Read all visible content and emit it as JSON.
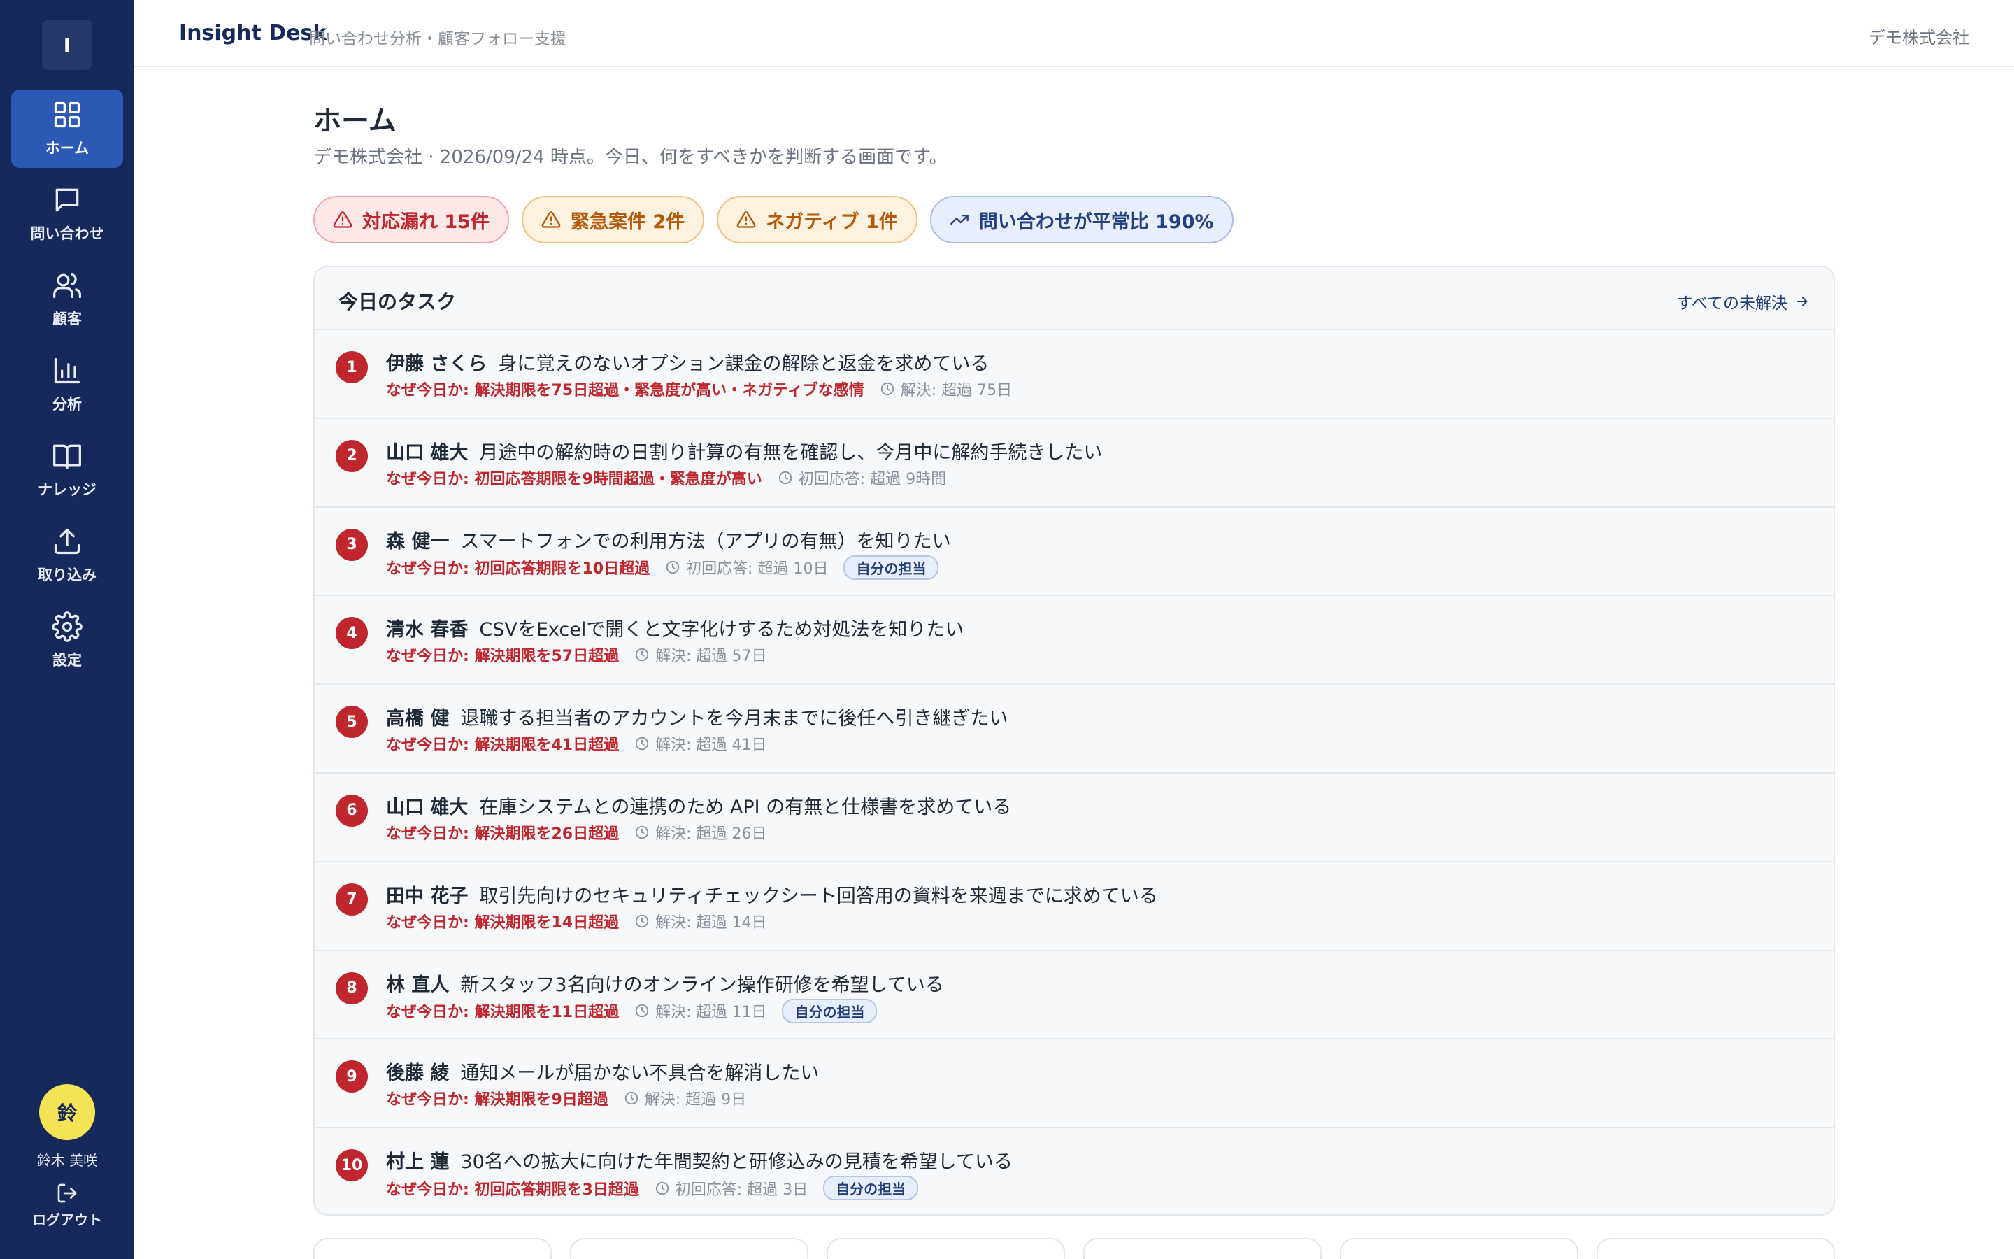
{
  "app": {
    "logo_letter": "I",
    "brand": "Insight Desk",
    "tagline": "問い合わせ分析・顧客フォロー支援",
    "company": "デモ株式会社"
  },
  "sidebar": {
    "items": [
      {
        "label": "ホーム",
        "icon": "grid-icon",
        "active": true
      },
      {
        "label": "問い合わせ",
        "icon": "chat-icon",
        "active": false
      },
      {
        "label": "顧客",
        "icon": "users-icon",
        "active": false
      },
      {
        "label": "分析",
        "icon": "bar-chart-icon",
        "active": false
      },
      {
        "label": "ナレッジ",
        "icon": "book-icon",
        "active": false
      },
      {
        "label": "取り込み",
        "icon": "upload-icon",
        "active": false
      },
      {
        "label": "設定",
        "icon": "gear-icon",
        "active": false
      }
    ],
    "user": {
      "avatar_initial": "鈴",
      "name": "鈴木 美咲"
    },
    "logout_label": "ログアウト"
  },
  "page": {
    "title": "ホーム",
    "subtitle": "デモ株式会社 · 2026/09/24 時点。今日、何をすべきかを判断する画面です。"
  },
  "alerts": [
    {
      "label": "対応漏れ 15件",
      "icon": "warning-icon",
      "tone": "red"
    },
    {
      "label": "緊急案件 2件",
      "icon": "warning-icon",
      "tone": "orange"
    },
    {
      "label": "ネガティブ 1件",
      "icon": "warning-icon",
      "tone": "orange"
    },
    {
      "label": "問い合わせが平常比 190%",
      "icon": "trending-up-icon",
      "tone": "blue"
    }
  ],
  "tasks": {
    "title": "今日のタスク",
    "view_all_label": "すべての未解決",
    "rows": [
      {
        "num": "1",
        "name": "伊藤 さくら",
        "summary": "身に覚えのないオプション課金の解除と返金を求めている",
        "reason": "なぜ今日か: 解決期限を75日超過・緊急度が高い・ネガティブな感情",
        "meta": "解決: 超過 75日",
        "badge": ""
      },
      {
        "num": "2",
        "name": "山口 雄大",
        "summary": "月途中の解約時の日割り計算の有無を確認し、今月中に解約手続きしたい",
        "reason": "なぜ今日か: 初回応答期限を9時間超過・緊急度が高い",
        "meta": "初回応答: 超過 9時間",
        "badge": ""
      },
      {
        "num": "3",
        "name": "森 健一",
        "summary": "スマートフォンでの利用方法（アプリの有無）を知りたい",
        "reason": "なぜ今日か: 初回応答期限を10日超過",
        "meta": "初回応答: 超過 10日",
        "badge": "自分の担当"
      },
      {
        "num": "4",
        "name": "清水 春香",
        "summary": "CSVをExcelで開くと文字化けするため対処法を知りたい",
        "reason": "なぜ今日か: 解決期限を57日超過",
        "meta": "解決: 超過 57日",
        "badge": ""
      },
      {
        "num": "5",
        "name": "高橋 健",
        "summary": "退職する担当者のアカウントを今月末までに後任へ引き継ぎたい",
        "reason": "なぜ今日か: 解決期限を41日超過",
        "meta": "解決: 超過 41日",
        "badge": ""
      },
      {
        "num": "6",
        "name": "山口 雄大",
        "summary": "在庫システムとの連携のため API の有無と仕様書を求めている",
        "reason": "なぜ今日か: 解決期限を26日超過",
        "meta": "解決: 超過 26日",
        "badge": ""
      },
      {
        "num": "7",
        "name": "田中 花子",
        "summary": "取引先向けのセキュリティチェックシート回答用の資料を来週までに求めている",
        "reason": "なぜ今日か: 解決期限を14日超過",
        "meta": "解決: 超過 14日",
        "badge": ""
      },
      {
        "num": "8",
        "name": "林 直人",
        "summary": "新スタッフ3名向けのオンライン操作研修を希望している",
        "reason": "なぜ今日か: 解決期限を11日超過",
        "meta": "解決: 超過 11日",
        "badge": "自分の担当"
      },
      {
        "num": "9",
        "name": "後藤 綾",
        "summary": "通知メールが届かない不具合を解消したい",
        "reason": "なぜ今日か: 解決期限を9日超過",
        "meta": "解決: 超過 9日",
        "badge": ""
      },
      {
        "num": "10",
        "name": "村上 蓮",
        "summary": "30名への拡大に向けた年間契約と研修込みの見積を希望している",
        "reason": "なぜ今日か: 初回応答期限を3日超過",
        "meta": "初回応答: 超過 3日",
        "badge": "自分の担当"
      }
    ]
  },
  "colors": {
    "sidebar_bg": "#15295b",
    "active_nav": "#2c59b5",
    "danger": "#c0262d",
    "warning": "#b4590a",
    "info": "#24427f",
    "avatar_bg": "#f5e356"
  }
}
